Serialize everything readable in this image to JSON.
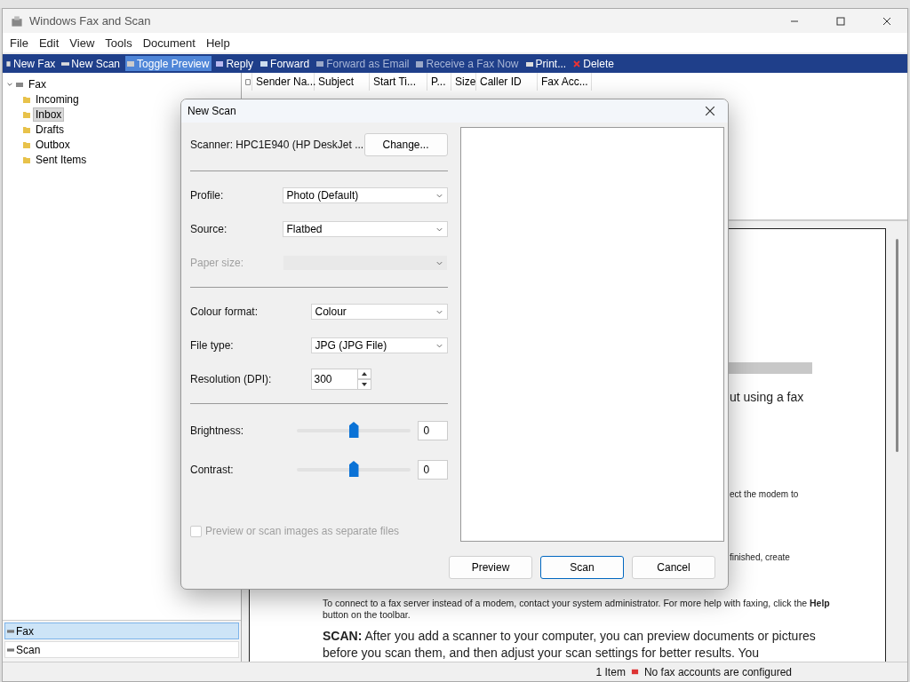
{
  "window": {
    "title": "Windows Fax and Scan"
  },
  "menu": [
    "File",
    "Edit",
    "View",
    "Tools",
    "Document",
    "Help"
  ],
  "toolbar": [
    {
      "label": "New Fax",
      "disabled": false,
      "highlighted": false
    },
    {
      "label": "New Scan",
      "disabled": false,
      "highlighted": false
    },
    {
      "label": "Toggle Preview",
      "disabled": false,
      "highlighted": true
    },
    {
      "label": "Reply",
      "disabled": false,
      "highlighted": false
    },
    {
      "label": "Forward",
      "disabled": false,
      "highlighted": false
    },
    {
      "label": "Forward as Email",
      "disabled": true,
      "highlighted": false
    },
    {
      "label": "Receive a Fax Now",
      "disabled": true,
      "highlighted": false
    },
    {
      "label": "Print...",
      "disabled": false,
      "highlighted": false
    },
    {
      "label": "Delete",
      "disabled": false,
      "highlighted": false
    }
  ],
  "tree": {
    "label": "Fax",
    "expanded": true,
    "children": [
      {
        "label": "Incoming",
        "selected": false
      },
      {
        "label": "Inbox",
        "selected": true
      },
      {
        "label": "Drafts",
        "selected": false
      },
      {
        "label": "Outbox",
        "selected": false
      },
      {
        "label": "Sent Items",
        "selected": false
      }
    ]
  },
  "nav": [
    {
      "label": "Fax",
      "selected": true
    },
    {
      "label": "Scan",
      "selected": false
    }
  ],
  "list": {
    "columns": [
      "Sender Na...",
      "Subject",
      "Start Ti...",
      "P...",
      "Size",
      "Caller ID",
      "Fax Acc..."
    ]
  },
  "preview": {
    "fragments": [
      "ut using a fax",
      "ect the modem to",
      "finished, create"
    ],
    "note": "To connect to a fax server instead of a modem, contact your system administrator. For more help with faxing, click the **Help** button on the toolbar.",
    "scan_heading": "SCAN:",
    "scan_text": "After you add a scanner to your computer, you can preview documents or pictures before you scan them, and then adjust your scan settings for better results. You"
  },
  "status_bar": {
    "count": "1 Item",
    "message": "No fax accounts are configured"
  },
  "dialog": {
    "title": "New Scan",
    "scanner": "Scanner: HPC1E940 (HP DeskJet ...",
    "change_button": "Change...",
    "groups": [
      [
        {
          "kind": "select",
          "label": "Profile:",
          "value": "Photo (Default)",
          "disabled": false
        },
        {
          "kind": "select",
          "label": "Source:",
          "value": "Flatbed",
          "disabled": false
        },
        {
          "kind": "select",
          "label": "Paper size:",
          "disabled": true
        }
      ],
      [
        {
          "kind": "select",
          "label": "Colour format:",
          "value": "Colour",
          "disabled": false
        },
        {
          "kind": "select",
          "label": "File type:",
          "value": "JPG (JPG File)",
          "disabled": false
        },
        {
          "kind": "spin",
          "label": "Resolution (DPI):",
          "value": "300"
        }
      ],
      [
        {
          "kind": "slider",
          "label": "Brightness:",
          "level": 0.5,
          "value": "0"
        },
        {
          "kind": "slider",
          "label": "Contrast:",
          "level": 0.5,
          "value": "0"
        }
      ]
    ],
    "checkbox": {
      "label": "Preview or scan images as separate files",
      "checked": false,
      "disabled": true
    },
    "buttons": [
      {
        "label": "Preview",
        "default": false
      },
      {
        "label": "Scan",
        "default": true
      },
      {
        "label": "Cancel",
        "default": false
      }
    ]
  }
}
